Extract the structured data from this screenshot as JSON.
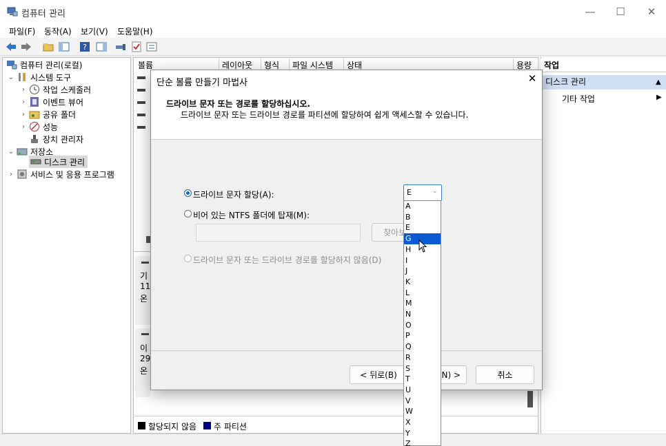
{
  "window": {
    "title": "컴퓨터 관리",
    "controls": {
      "minimize": "—",
      "maximize": "☐",
      "close": "✕"
    }
  },
  "menu": [
    "파일(F)",
    "동작(A)",
    "보기(V)",
    "도움말(H)"
  ],
  "tree": {
    "root": "컴퓨터 관리(로컬)",
    "items": [
      {
        "label": "시스템 도구",
        "icon": "tools-icon"
      },
      {
        "label": "작업 스케줄러",
        "icon": "clock-icon"
      },
      {
        "label": "이벤트 뷰어",
        "icon": "event-viewer-icon"
      },
      {
        "label": "공유 폴더",
        "icon": "shared-folder-icon"
      },
      {
        "label": "성능",
        "icon": "performance-icon"
      },
      {
        "label": "장치 관리자",
        "icon": "device-manager-icon"
      },
      {
        "label": "저장소",
        "icon": "storage-icon"
      },
      {
        "label": "디스크 관리",
        "icon": "disk-icon"
      },
      {
        "label": "서비스 및 응용 프로그램",
        "icon": "services-icon"
      }
    ]
  },
  "volume_table": {
    "columns": [
      "볼륨",
      "레이아웃",
      "형식",
      "파일 시스템",
      "상태",
      "용량"
    ]
  },
  "disk_panel": {
    "disk1_lines": [
      "기",
      "11",
      "온"
    ],
    "disk2_lines": [
      "이",
      "29.",
      "온"
    ]
  },
  "legend": [
    {
      "label": "할당되지 않음",
      "color": "#000000"
    },
    {
      "label": "주 파티션",
      "color": "#000080"
    }
  ],
  "actions": {
    "header": "작업",
    "section": "디스크 관리",
    "more": "기타 작업"
  },
  "dialog": {
    "title": "단순 볼륨 만들기 마법사",
    "heading": "드라이브 문자 또는 경로를 할당하십시오.",
    "subheading": "드라이브 문자 또는 드라이브 경로를 파티션에 할당하여 쉽게 액세스할 수 있습니다.",
    "option_assign": "드라이브 문자 할당(A):",
    "option_mount": "비어 있는 NTFS 폴더에 탑재(M):",
    "browse": "찾아보",
    "option_none": "드라이브 문자 또는 드라이브 경로를 할당하지 않음(D)",
    "selected_letter": "E",
    "back_button": "< 뒤로(B)",
    "next_button": "N) >",
    "cancel_button": "취소",
    "letters": [
      "A",
      "B",
      "E",
      "G",
      "H",
      "I",
      "J",
      "K",
      "L",
      "M",
      "N",
      "O",
      "P",
      "Q",
      "R",
      "S",
      "T",
      "U",
      "V",
      "W",
      "X",
      "Y",
      "Z"
    ],
    "highlighted_letter": "G"
  }
}
